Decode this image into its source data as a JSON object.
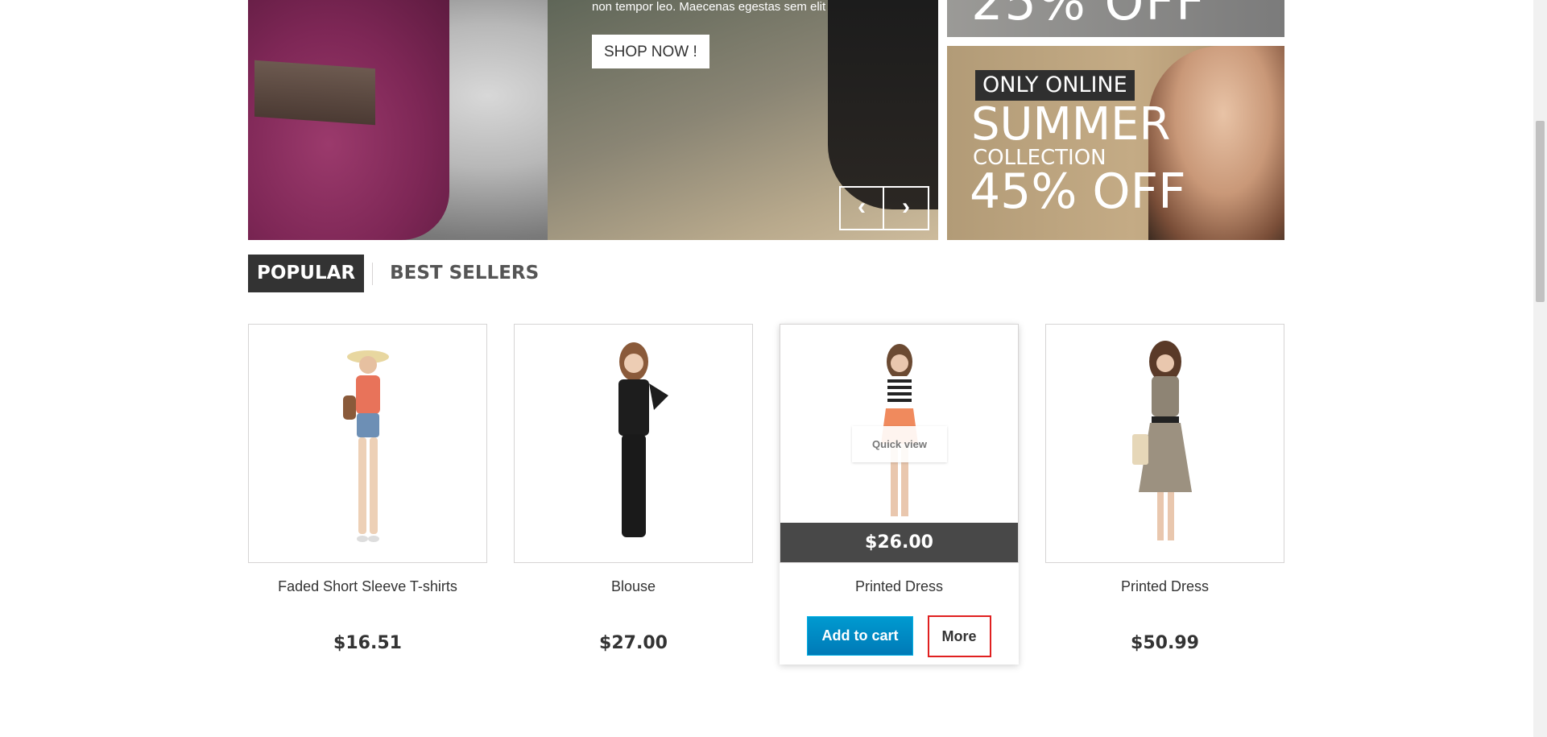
{
  "slider": {
    "caption": "non tempor leo. Maecenas egestas sem elit",
    "shop_now": "SHOP NOW !",
    "prev_icon": "chevron-left-icon",
    "next_icon": "chevron-right-icon",
    "prev_glyph": "‹",
    "next_glyph": "›"
  },
  "banners": {
    "top_partial_text": "25% OFF",
    "bottom_tag": "ONLY ONLINE",
    "bottom_line1": "SUMMER",
    "bottom_line2": "COLLECTION",
    "bottom_line3": "45% OFF"
  },
  "tabs": [
    {
      "label": "POPULAR",
      "active": true
    },
    {
      "label": "BEST SELLERS",
      "active": false
    }
  ],
  "products": [
    {
      "name": "Faded Short Sleeve T-shirts",
      "price": "$16.51"
    },
    {
      "name": "Blouse",
      "price": "$27.00"
    },
    {
      "name": "Printed Dress",
      "price": "$26.00",
      "quick_view": "Quick view",
      "add_to_cart": "Add to cart",
      "more": "More"
    },
    {
      "name": "Printed Dress",
      "price": "$50.99"
    }
  ],
  "colors": {
    "tab_active_bg": "#333333",
    "cart_button": "#0e8fc9",
    "more_border": "#e02020",
    "price_bar": "#484848"
  }
}
